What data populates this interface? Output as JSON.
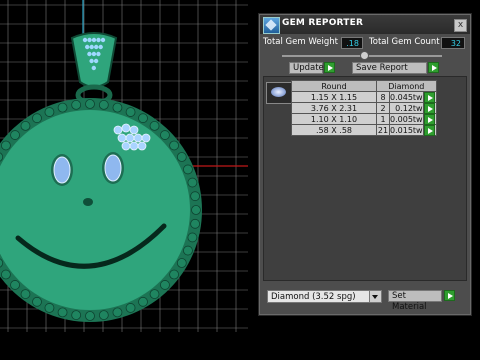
{
  "viewport": {
    "description_icon": "smiley-pendant-3d-model",
    "grid_color": "#7a7a7a",
    "axis_x_color": "#c01818",
    "axis_y_color": "#2aa6c8",
    "model_color": "#2fa57c"
  },
  "panel": {
    "title": "GEM REPORTER",
    "close_label": "x",
    "total_gem_weight_label": "Total Gem Weight",
    "total_gem_weight_value": ".18",
    "total_gem_count_label": "Total Gem Count",
    "total_gem_count_value": "32",
    "update_label": "Update",
    "save_report_label": "Save Report",
    "table": {
      "headers": [
        "Round",
        "Diamond"
      ],
      "rows": [
        {
          "size": "1.15 X 1.15",
          "count": "8",
          "weight": "0.045tw"
        },
        {
          "size": "3.76 X 2.31",
          "count": "2",
          "weight": "0.12tw"
        },
        {
          "size": "1.10 X 1.10",
          "count": "1",
          "weight": "0.005tw"
        },
        {
          "size": ".58 X .58",
          "count": "21",
          "weight": "0.015tw"
        }
      ]
    },
    "material_select_value": "Diamond    (3.52 spg)",
    "set_material_label": "Set Material",
    "accent_go_color": "#2f9e2f",
    "value_text_color": "#36d0e8"
  }
}
